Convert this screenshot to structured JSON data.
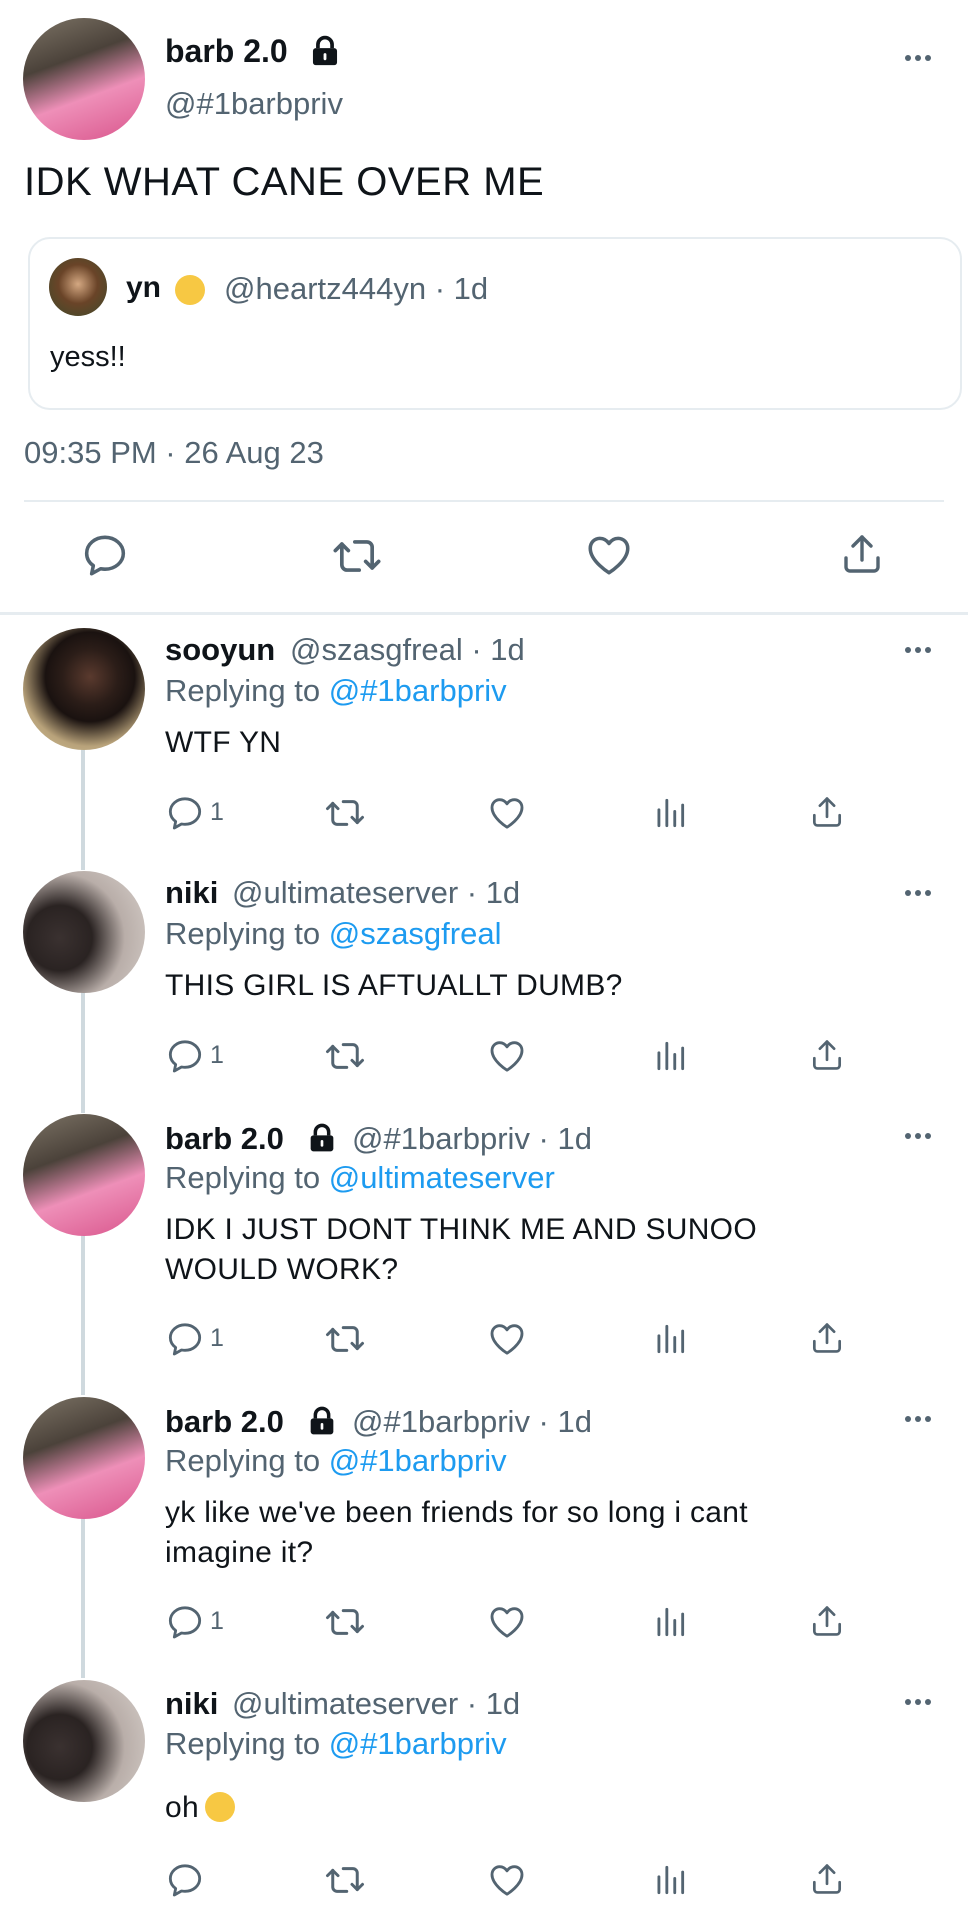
{
  "main_tweet": {
    "author_name": "barb 2.0",
    "handle": "@#1barbpriv",
    "text": "IDK WHAT CANE OVER ME",
    "quoted": {
      "author_name": "yn",
      "handle_time": "@heartz444yn · 1d",
      "text": "yess!!"
    },
    "timestamp": "09:35 PM · 26 Aug 23"
  },
  "replies": [
    {
      "author_name": "sooyun",
      "handle_time": "@szasgfreal · 1d",
      "replying_prefix": "Replying to",
      "replying_mention": "@#1barbpriv",
      "text": "WTF YN",
      "reply_count": "1"
    },
    {
      "author_name": "niki",
      "handle_time": "@ultimateserver · 1d",
      "replying_prefix": "Replying to",
      "replying_mention": "@szasgfreal",
      "text": "THIS GIRL IS AFTUALLT DUMB?",
      "reply_count": "1"
    },
    {
      "author_name": "barb 2.0",
      "handle_time": "@#1barbpriv · 1d",
      "replying_prefix": "Replying to",
      "replying_mention": "@ultimateserver",
      "text_line1": "IDK I JUST DONT THINK ME AND SUNOO",
      "text_line2": "WOULD WORK?",
      "reply_count": "1"
    },
    {
      "author_name": "barb 2.0",
      "handle_time": "@#1barbpriv · 1d",
      "replying_prefix": "Replying to",
      "replying_mention": "@#1barbpriv",
      "text_line1": "yk like we've been friends for so long i cant",
      "text_line2": "imagine it?",
      "reply_count": "1"
    },
    {
      "author_name": "niki",
      "handle_time": "@ultimateserver · 1d",
      "replying_prefix": "Replying to",
      "replying_mention": "@#1barbpriv",
      "text": "oh"
    }
  ],
  "icons": {
    "verified_lock": "lock-icon",
    "reply": "reply-icon",
    "retweet": "retweet-icon",
    "like": "heart-icon",
    "analytics": "analytics-icon",
    "share": "share-icon",
    "more": "more-icon"
  },
  "colors": {
    "text": "#0f1419",
    "secondary": "#536471",
    "link": "#1d9bf0",
    "divider": "#e6ecf0"
  }
}
